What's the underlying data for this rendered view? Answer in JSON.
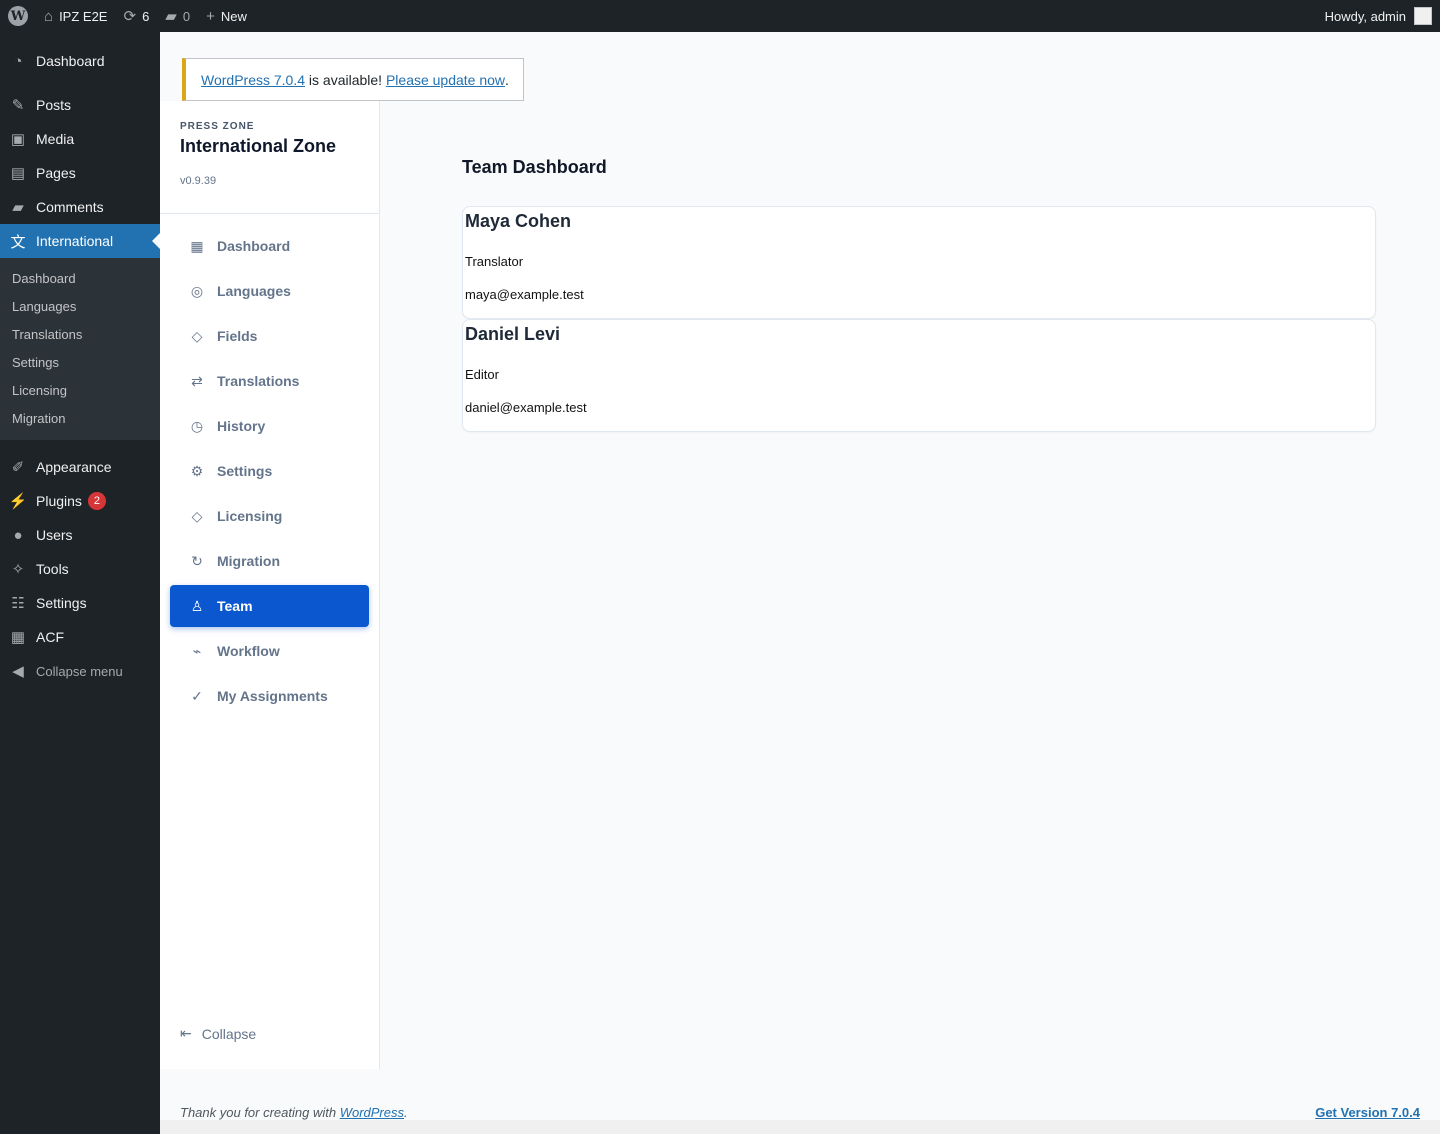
{
  "adminbar": {
    "site_name": "IPZ E2E",
    "updates_count": "6",
    "comments_count": "0",
    "new_label": "New",
    "howdy": "Howdy, admin"
  },
  "wp_menu": {
    "dashboard": "Dashboard",
    "posts": "Posts",
    "media": "Media",
    "pages": "Pages",
    "comments": "Comments",
    "international": "International",
    "submenu": [
      "Dashboard",
      "Languages",
      "Translations",
      "Settings",
      "Licensing",
      "Migration"
    ],
    "appearance": "Appearance",
    "plugins": "Plugins",
    "plugins_badge": "2",
    "users": "Users",
    "tools": "Tools",
    "settings": "Settings",
    "acf": "ACF",
    "collapse": "Collapse menu"
  },
  "notice": {
    "link1": "WordPress 7.0.4",
    "text": " is available! ",
    "link2": "Please update now",
    "end": "."
  },
  "plugin": {
    "eyebrow": "PRESS ZONE",
    "name": "International Zone",
    "version": "v0.9.39",
    "nav": [
      {
        "label": "Dashboard",
        "icon": "▦"
      },
      {
        "label": "Languages",
        "icon": "◎"
      },
      {
        "label": "Fields",
        "icon": "◇"
      },
      {
        "label": "Translations",
        "icon": "⇄"
      },
      {
        "label": "History",
        "icon": "◷"
      },
      {
        "label": "Settings",
        "icon": "⚙"
      },
      {
        "label": "Licensing",
        "icon": "◇"
      },
      {
        "label": "Migration",
        "icon": "↻"
      },
      {
        "label": "Team",
        "icon": "♙"
      },
      {
        "label": "Workflow",
        "icon": "⌁"
      },
      {
        "label": "My Assignments",
        "icon": "✓"
      }
    ],
    "collapse": "Collapse",
    "collapse_icon": "⇤"
  },
  "main": {
    "title": "Team Dashboard",
    "members": [
      {
        "name": "Maya Cohen",
        "role": "Translator",
        "email": "maya@example.test"
      },
      {
        "name": "Daniel Levi",
        "role": "Editor",
        "email": "daniel@example.test"
      }
    ]
  },
  "footer": {
    "thanks_prefix": "Thank you for creating with ",
    "thanks_link": "WordPress",
    "thanks_suffix": ".",
    "get_version": "Get Version 7.0.4"
  }
}
